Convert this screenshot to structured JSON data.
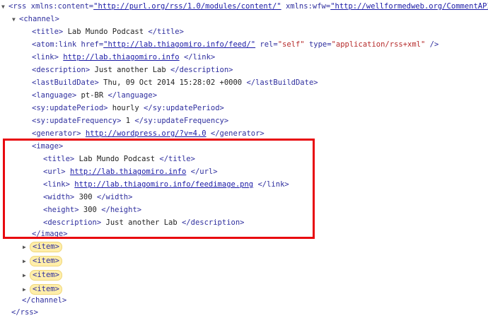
{
  "rss": {
    "open_prefix": "<rss",
    "attr1_name": " xmlns:content=",
    "attr1_value": "\"http://purl.org/rss/1.0/modules/content/\"",
    "attr2_name": " xmlns:wfw=",
    "attr2_value": "\"http://wellformedweb.org/CommentAPI/\"",
    "attr2_tail": " >",
    "close": "</rss>"
  },
  "channel": {
    "open": "<channel>",
    "close": "</channel>",
    "title": {
      "open": "<title>",
      "text": " Lab Mundo Podcast ",
      "close": "</title>"
    },
    "atom": {
      "open": "<atom:link",
      "href_name": " href=",
      "href_value": "\"http://lab.thiagomiro.info/feed/\"",
      "rel_name": " rel=",
      "rel_value": "\"self\"",
      "type_name": " type=",
      "type_value": "\"application/rss+xml\"",
      "close": " />"
    },
    "link": {
      "open": "<link>",
      "url": "http://lab.thiagomiro.info",
      "close": " </link>"
    },
    "description": {
      "open": "<description>",
      "text": " Just another Lab ",
      "close": "</description>"
    },
    "lastBuildDate": {
      "open": "<lastBuildDate>",
      "text": " Thu, 09 Oct 2014 15:28:02 +0000 ",
      "close": "</lastBuildDate>"
    },
    "language": {
      "open": "<language>",
      "text": " pt-BR ",
      "close": "</language>"
    },
    "updatePeriod": {
      "open": "<sy:updatePeriod>",
      "text": " hourly ",
      "close": "</sy:updatePeriod>"
    },
    "updateFrequency": {
      "open": "<sy:updateFrequency>",
      "text": " 1 ",
      "close": "</sy:updateFrequency>"
    },
    "generator": {
      "open": "<generator>",
      "url": "http://wordpress.org/?v=4.0",
      "close": " </generator>"
    },
    "image": {
      "open": "<image>",
      "close": "</image>",
      "title": {
        "open": "<title>",
        "text": " Lab Mundo Podcast ",
        "close": "</title>"
      },
      "url": {
        "open": "<url>",
        "url": "http://lab.thiagomiro.info",
        "close": " </url>"
      },
      "link": {
        "open": "<link>",
        "url": "http://lab.thiagomiro.info/feedimage.png",
        "close": " </link>"
      },
      "width": {
        "open": "<width>",
        "text": " 300 ",
        "close": "</width>"
      },
      "height": {
        "open": "<height>",
        "text": " 300 ",
        "close": "</height>"
      },
      "description": {
        "open": "<description>",
        "text": " Just another Lab ",
        "close": "</description>"
      }
    },
    "items": [
      "<item>",
      "<item>",
      "<item>",
      "<item>"
    ]
  },
  "highlight_color": "#e8090f",
  "icons": {
    "expanded": "triangle-down-icon",
    "collapsed": "triangle-right-icon"
  }
}
